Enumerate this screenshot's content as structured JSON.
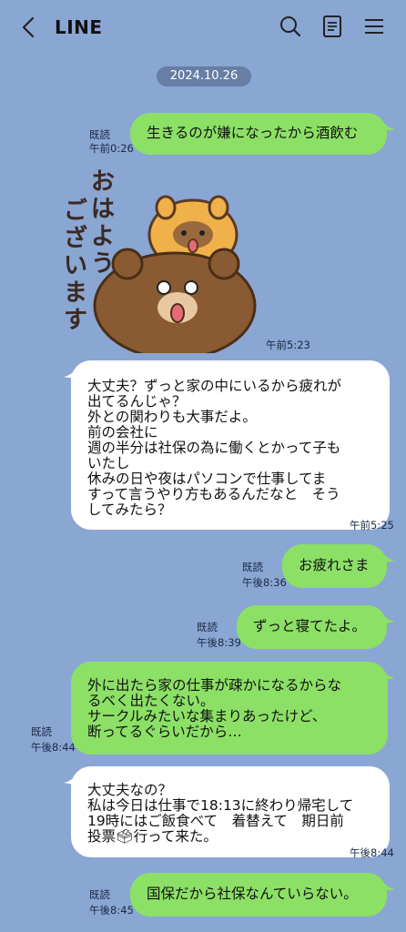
{
  "header": {
    "title": "LINE"
  },
  "date_label": "2024.10.26",
  "messages": [
    {
      "text": "生きるのが嫌になったから酒飲む",
      "read": "既読",
      "time": "午前0:26"
    },
    {
      "sticker_text": "おはよう\nございます",
      "time": "午前5:23"
    },
    {
      "text": "大丈夫？ずっと家の中にいるから疲れが\n出てるんじゃ？\n外との関わりも大事だよ。\n前の会社に\n週の半分は社保の為に働くとかって子も\nいたし\n休みの日や夜はパソコンで仕事してま\nすって言うやり方もあるんだなと　そう\nしてみたら？",
      "time": "午前5:25"
    },
    {
      "text": "お疲れさま",
      "read": "既読",
      "time": "午後8:36"
    },
    {
      "text": "ずっと寝てたよ。",
      "read": "既読",
      "time": "午後8:39"
    },
    {
      "text": "外に出たら家の仕事が疎かになるからな\nるべく出たくない。\nサークルみたいな集まりあったけど、\n断ってるぐらいだから…",
      "read": "既読",
      "time": "午後8:44"
    },
    {
      "text": "大丈夫なの？\n私は今日は仕事で18:13に終わり帰宅して\n19時にはご飯食べて　着替えて　期日前\n投票🗳行って来た。",
      "time": "午後8:44"
    },
    {
      "text": "国保だから社保なんていらない。",
      "read": "既読",
      "time": "午後8:45"
    }
  ],
  "colors": {
    "background": "#8aa6d3",
    "sent_bubble": "#8ce066",
    "received_bubble": "#ffffff"
  }
}
